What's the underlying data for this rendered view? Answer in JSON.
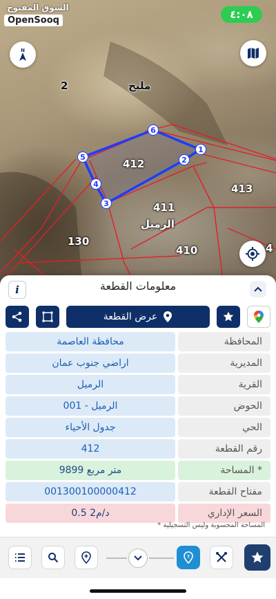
{
  "status_bar": {
    "brand_ar": "السوق المفتوح",
    "brand_en": "OpenSooq",
    "time": "٤:٠٨"
  },
  "map": {
    "labels": {
      "region": "مليح",
      "parcel_2": "2",
      "parcel_412": "412",
      "parcel_413": "413",
      "parcel_411": "411",
      "village": "الرميل",
      "parcel_130": "130",
      "parcel_410": "410",
      "parcel_edge": "4"
    },
    "vertices": [
      "1",
      "2",
      "3",
      "4",
      "5",
      "6"
    ],
    "colors": {
      "selected_outline": "#1e3cff",
      "parcel_lines": "#e0202a"
    }
  },
  "panel": {
    "title": "معلومات القطعة",
    "show_parcel_label": "عرض القطعة",
    "rows": [
      {
        "label": "المحافظة",
        "value": "محافظة العاصمة"
      },
      {
        "label": "المديرية",
        "value": "اراضي جنوب عمان"
      },
      {
        "label": "القرية",
        "value": "الرميل"
      },
      {
        "label": "الحوض",
        "value": "الرميل - 001"
      },
      {
        "label": "الحي",
        "value": "جدول الأحياء"
      },
      {
        "label": "رقم القطعة",
        "value": "412"
      },
      {
        "label": "المساحة *",
        "value": "9899   متر مربع"
      },
      {
        "label": "مفتاح القطعة",
        "value": "001300100000412"
      },
      {
        "label": "السعر الإداري",
        "value": "0.5 د/م2"
      }
    ],
    "footnote": "* المساحة المحسوبة وليس التسجيلية"
  },
  "colors": {
    "brand_blue": "#0f2f68",
    "accent_blue": "#1f8fd4",
    "status_green": "#2dcc52"
  }
}
